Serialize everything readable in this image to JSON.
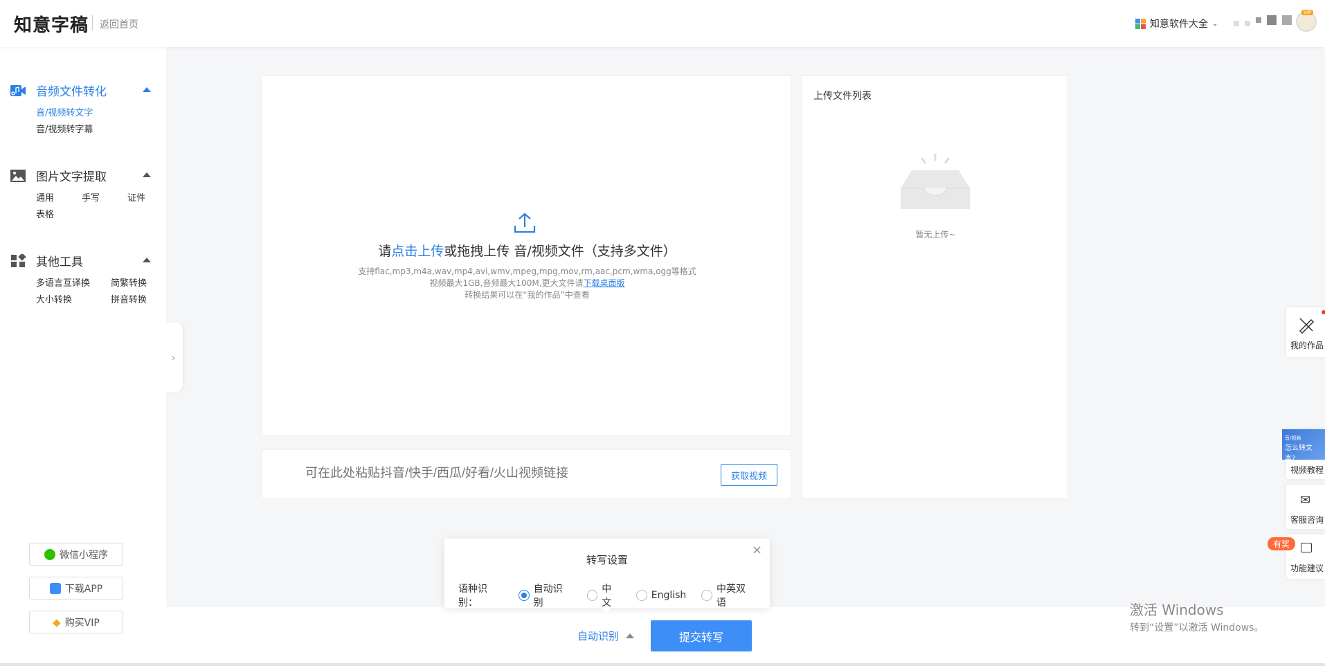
{
  "header": {
    "logo": "知意字稿",
    "home_link": "返回首页",
    "suite_label": "知意软件大全",
    "avatar_badge": "VIP"
  },
  "colors": {
    "accent": "#2b7fe6",
    "submit": "#3e8ef7"
  },
  "sidebar": {
    "sections": [
      {
        "title": "音频文件转化",
        "items": [
          "音/视频转文字",
          "音/视频转字幕"
        ]
      },
      {
        "title": "图片文字提取",
        "items": [
          "通用",
          "手写",
          "证件",
          "表格"
        ]
      },
      {
        "title": "其他工具",
        "items": [
          "多语言互译换",
          "简繁转换",
          "大小转换",
          "拼音转换"
        ]
      }
    ],
    "buttons": [
      "微信小程序",
      "下载APP",
      "购买VIP"
    ]
  },
  "upload": {
    "prefix": "请",
    "link": "点击上传",
    "suffix": "或拖拽上传 音/视频文件（支持多文件）",
    "formats": "支持flac,mp3,m4a,wav,mp4,avi,wmv,mpeg,mpg,mov,rm,aac,pcm,wma,ogg等格式",
    "size_prefix": "视频最大1GB,音频最大100M,更大文件请",
    "size_link": "下载桌面版",
    "result_hint": "转换结果可以在“我的作品”中查看"
  },
  "link_bar": {
    "placeholder": "可在此处粘贴抖音/快手/西瓜/好看/火山视频链接",
    "button": "获取视频"
  },
  "file_list": {
    "title": "上传文件列表",
    "empty": "暂无上传~"
  },
  "settings": {
    "title": "转写设置",
    "close": "×",
    "label": "语种识别：",
    "options": [
      "自动识别",
      "中文",
      "English",
      "中英双语"
    ],
    "selected": "自动识别"
  },
  "bottom": {
    "lang_selected": "自动识别",
    "submit": "提交转写"
  },
  "right_float": {
    "my_works": "我的作品",
    "tutorial_thumb": "怎么转文本?",
    "tutorial_small": "音/视频",
    "tutorial": "视频教程",
    "service": "客服咨询",
    "prize": "有奖",
    "feedback": "功能建议"
  },
  "os_watermark": {
    "line1": "激活 Windows",
    "line2": "转到“设置”以激活 Windows。"
  }
}
